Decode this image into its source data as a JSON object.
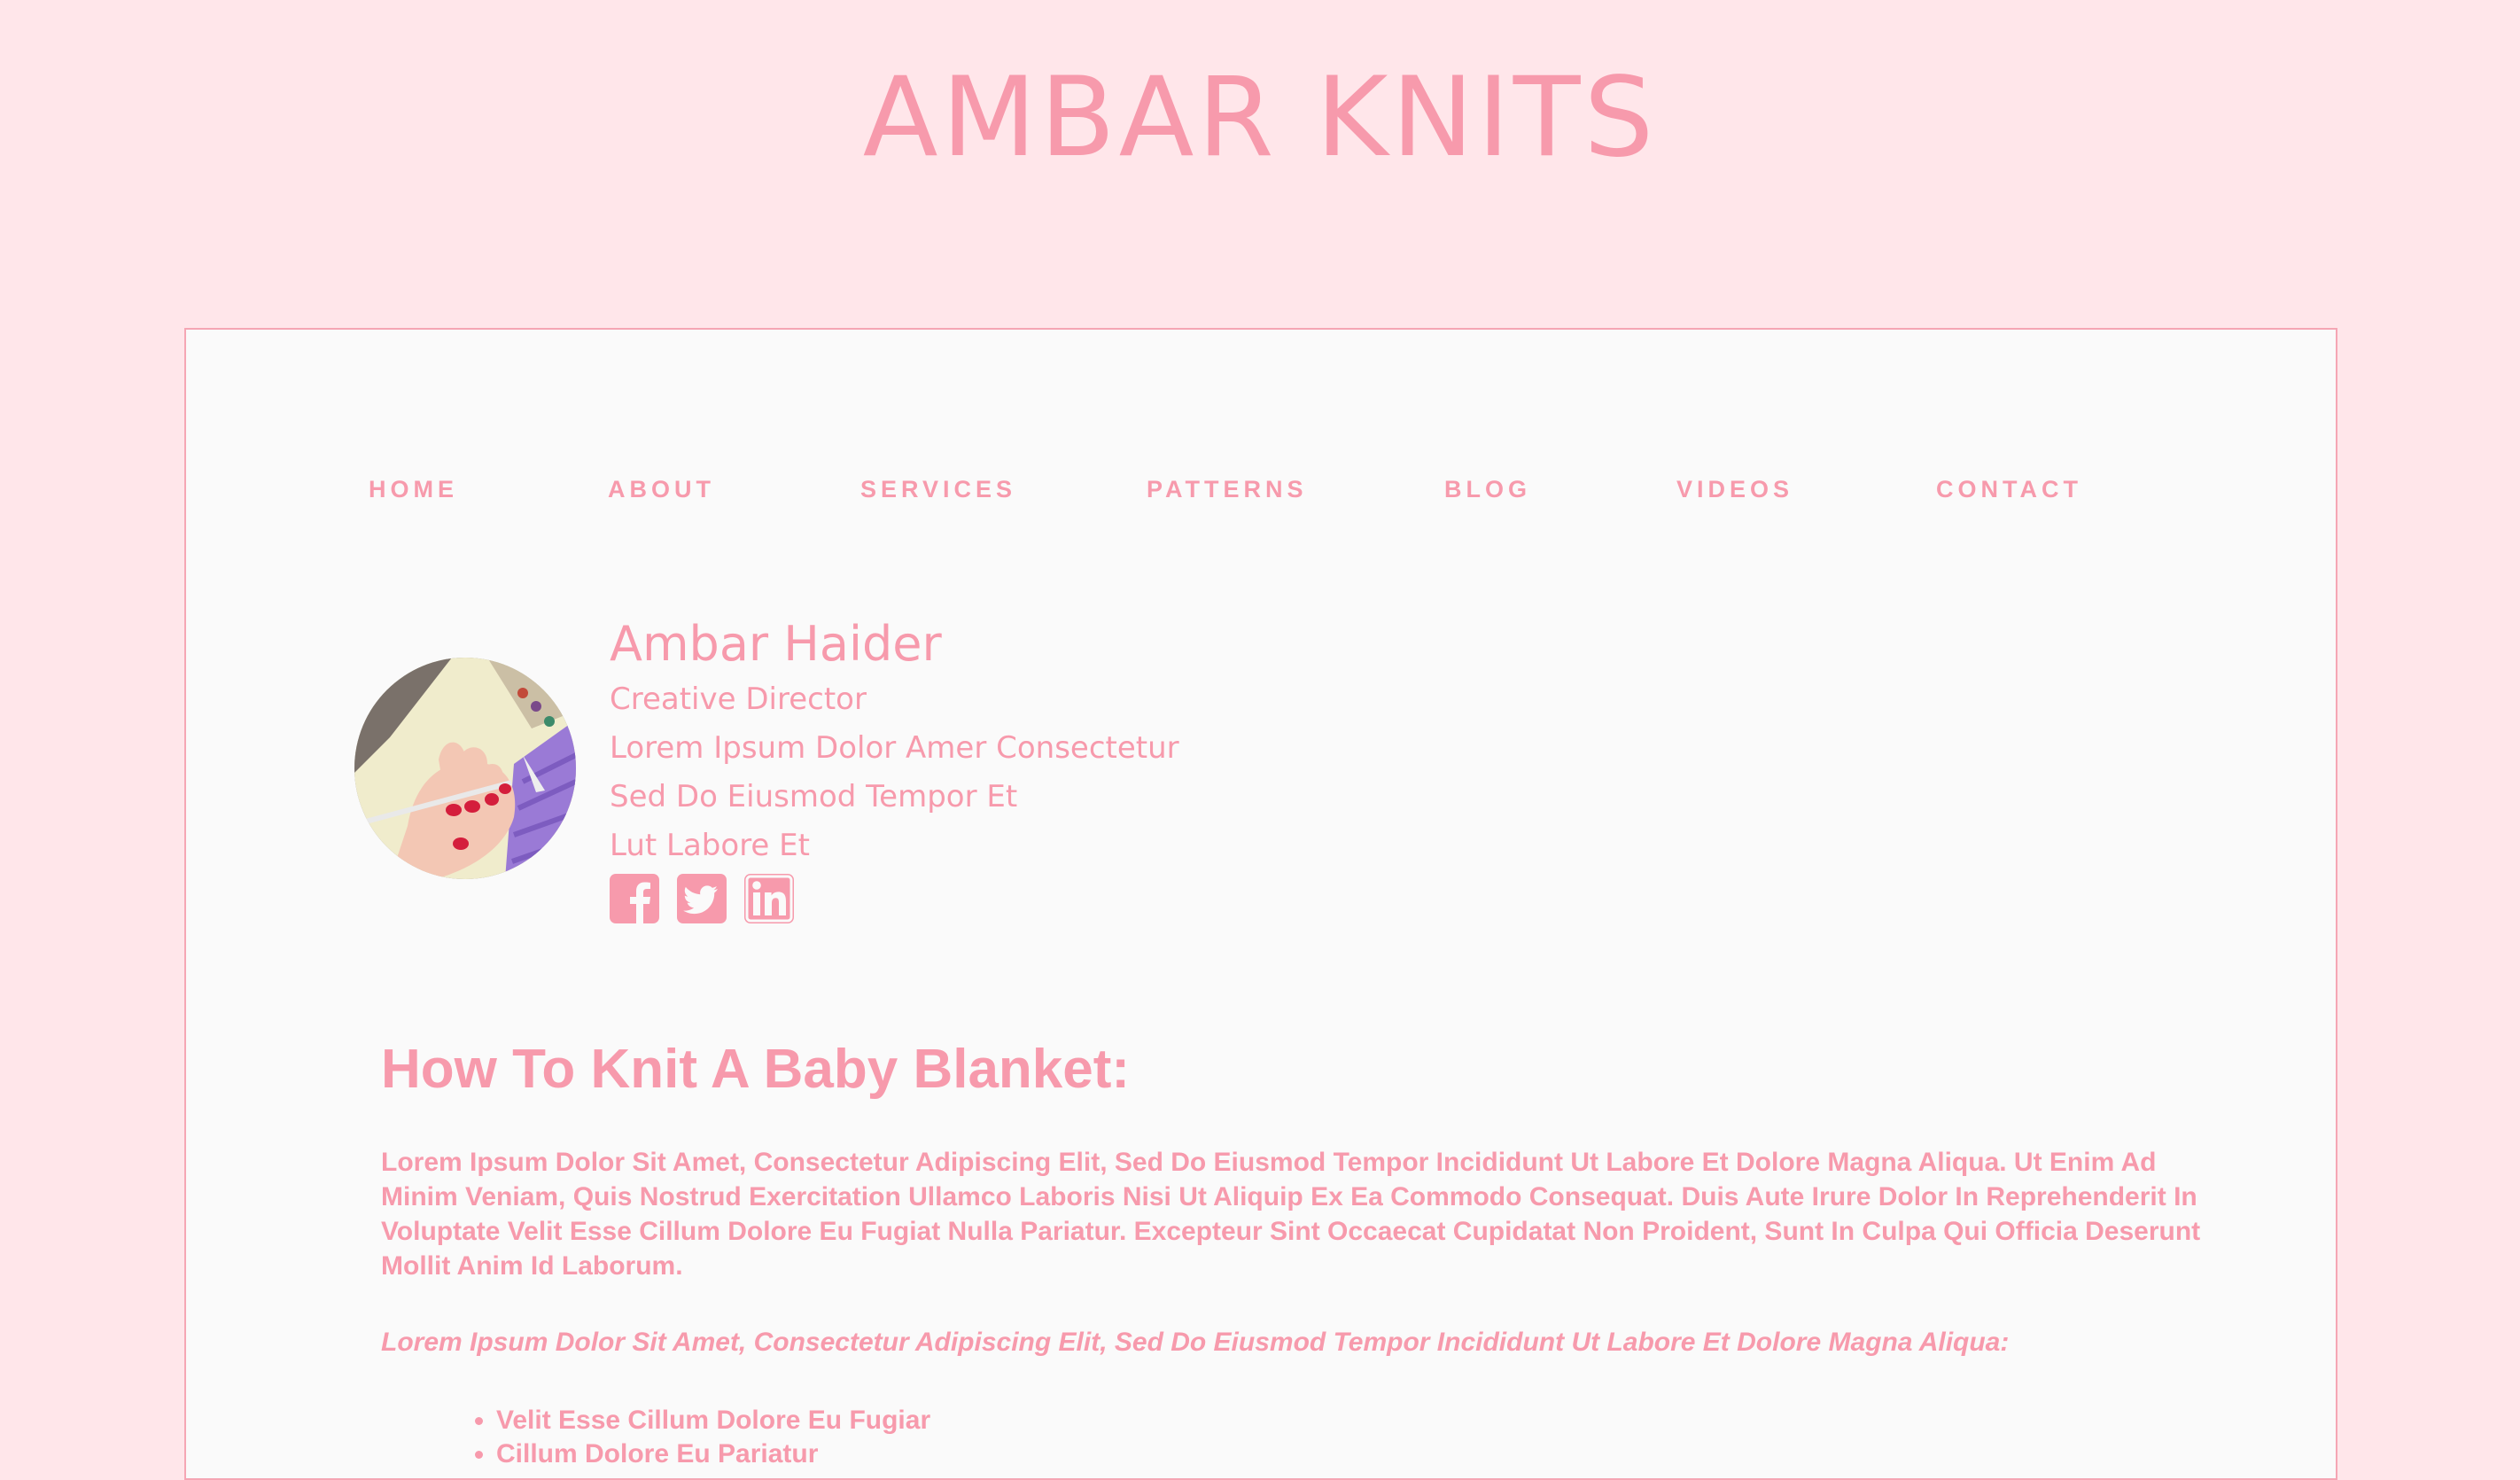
{
  "site": {
    "title": "AMBAR KNITS"
  },
  "nav": {
    "items": [
      "HOME",
      "ABOUT",
      "SERVICES",
      "PATTERNS",
      "BLOG",
      "VIDEOS",
      "CONTACT"
    ]
  },
  "profile": {
    "name": "Ambar Haider",
    "role": "Creative Director",
    "lines": [
      "Lorem Ipsum Dolor Amer Consectetur",
      "Sed Do Eiusmod Tempor Et",
      "Lut Labore Et"
    ],
    "socials": [
      "facebook-icon",
      "twitter-icon",
      "linkedin-icon"
    ]
  },
  "article": {
    "title": "How To Knit A Baby Blanket:",
    "body": "Lorem Ipsum Dolor Sit Amet, Consectetur Adipiscing Elit, Sed Do Eiusmod Tempor Incididunt Ut Labore Et Dolore Magna Aliqua. Ut Enim Ad Minim Veniam, Quis Nostrud Exercitation Ullamco Laboris Nisi Ut Aliquip Ex Ea Commodo Consequat. Duis Aute Irure Dolor In Reprehenderit In Voluptate Velit Esse Cillum Dolore Eu Fugiat Nulla Pariatur. Excepteur Sint Occaecat Cupidatat Non Proident, Sunt In Culpa Qui Officia Deserunt Mollit Anim Id Laborum.",
    "intro": "Lorem Ipsum Dolor Sit Amet, Consectetur Adipiscing Elit, Sed Do Eiusmod Tempor Incididunt Ut Labore Et Dolore Magna Aliqua:",
    "list": [
      "Velit Esse Cillum Dolore Eu Fugiar",
      "Cillum Dolore Eu Pariatur"
    ]
  },
  "colors": {
    "background": "#ffe6ea",
    "card": "#fafafa",
    "accent": "#f79aac"
  }
}
